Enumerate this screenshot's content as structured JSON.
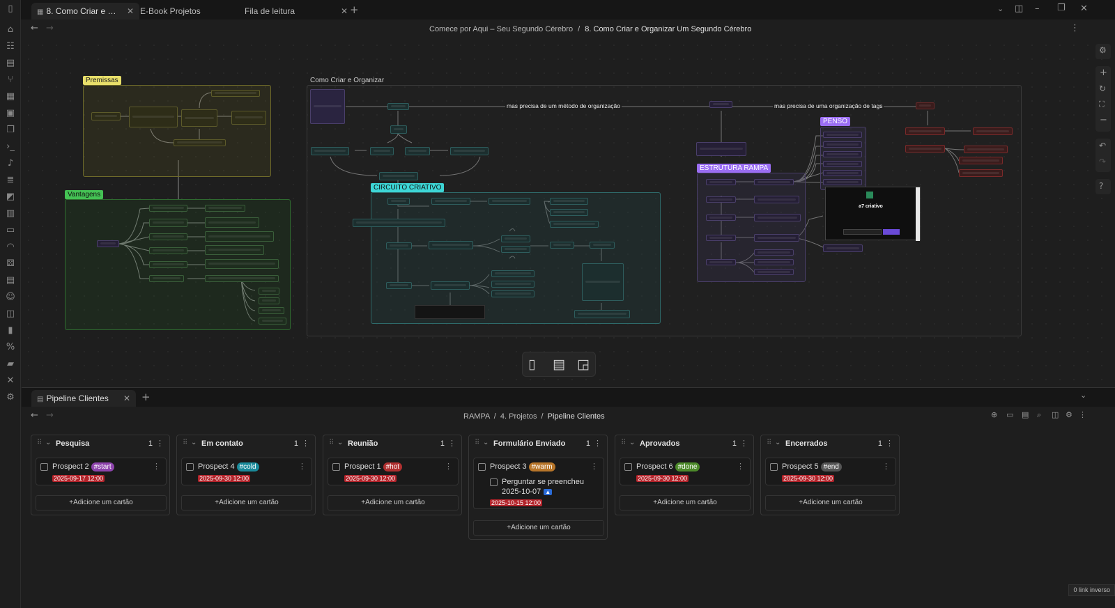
{
  "tabs": [
    {
      "label": "8. Como Criar e Organizar Um Segundo Cérebro",
      "active": true
    },
    {
      "label": "E-Book Projetos",
      "active": false
    },
    {
      "label": "Fila de leitura",
      "active": false
    }
  ],
  "top_breadcrumb": {
    "parent": "Comece por Aqui – Seu Segundo Cérebro",
    "separator": "/",
    "current": "8. Como Criar e Organizar Um Segundo Cérebro"
  },
  "canvas": {
    "groups": {
      "premissas": "Premissas",
      "vantagens": "Vantagens",
      "como_criar": "Como Criar e Organizar",
      "circuito": "CIRCUITO CRIATIVO",
      "penso": "PENSO",
      "estrutura": "ESTRUTURA RAMPA"
    },
    "edge_labels": {
      "metodo": "mas precisa de um método de organização",
      "tags": "mas precisa de uma organização de tags"
    },
    "embed_title": "a7 criativo"
  },
  "bottom_pane": {
    "tab_label": "Pipeline Clientes",
    "breadcrumb": [
      "RAMPA",
      "4. Projetos",
      "Pipeline Clientes"
    ]
  },
  "kanban": {
    "add_label": "+Adicione um cartão",
    "columns": [
      {
        "title": "Pesquisa",
        "count": "1",
        "cards": [
          {
            "title": "Prospect 2",
            "tag": "#start",
            "tag_color": "#8e44ad",
            "date": "2025-09-17  12:00"
          }
        ]
      },
      {
        "title": "Em contato",
        "count": "1",
        "cards": [
          {
            "title": "Prospect 4",
            "tag": "#cold",
            "tag_color": "#1a8a9a",
            "date": "2025-09-30  12:00"
          }
        ]
      },
      {
        "title": "Reunião",
        "count": "1",
        "cards": [
          {
            "title": "Prospect 1",
            "tag": "#hot",
            "tag_color": "#b03030",
            "date": "2025-09-30  12:00"
          }
        ]
      },
      {
        "title": "Formulário Enviado",
        "count": "1",
        "cards": [
          {
            "title": "Prospect 3",
            "tag": "#warm",
            "tag_color": "#b8762a",
            "subtask": "Perguntar se preencheu",
            "subtask_date": "2025-10-07",
            "date": "2025-10-15  12:00"
          }
        ]
      },
      {
        "title": "Aprovados",
        "count": "1",
        "cards": [
          {
            "title": "Prospect 6",
            "tag": "#done",
            "tag_color": "#4d8a2a",
            "date": "2025-09-30  12:00"
          }
        ]
      },
      {
        "title": "Encerrados",
        "count": "1",
        "cards": [
          {
            "title": "Prospect 5",
            "tag": "#end",
            "tag_color": "#555555",
            "date": "2025-09-30  12:00"
          }
        ]
      }
    ]
  },
  "status_bar": {
    "backlinks": "0 link inverso"
  },
  "icons": {
    "ribbon": [
      "home-icon",
      "files-icon",
      "file-icon",
      "graph-icon",
      "grid-icon",
      "calendar-icon",
      "copy-icon",
      "terminal-icon",
      "mic-icon",
      "list-icon",
      "image-icon",
      "layout-icon",
      "monitor-icon",
      "gauge-icon",
      "dice-icon",
      "calendar2-icon",
      "robot-icon",
      "layers-icon",
      "book-icon",
      "percent-icon",
      "stack-icon",
      "tools-icon",
      "settings-icon"
    ]
  }
}
